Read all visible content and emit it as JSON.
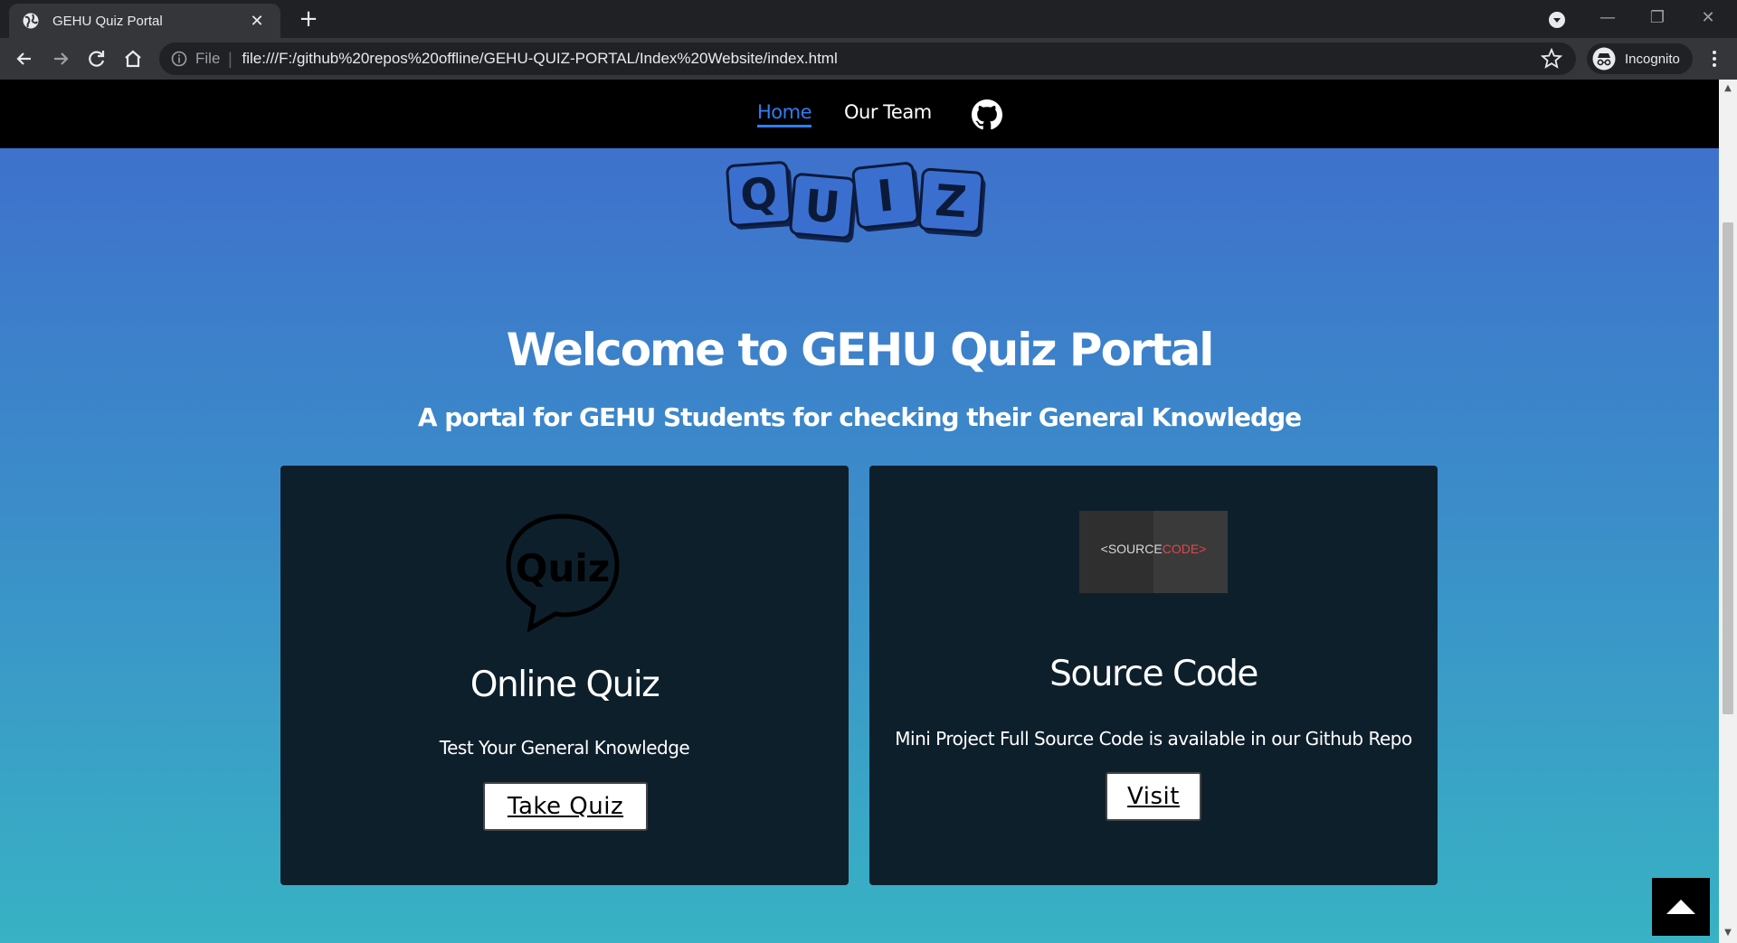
{
  "browser": {
    "tab_title": "GEHU Quiz Portal",
    "omnibox_scheme": "File",
    "url": "file:///F:/github%20repos%20offline/GEHU-QUIZ-PORTAL/Index%20Website/index.html",
    "profile_label": "Incognito"
  },
  "nav": {
    "home": "Home",
    "team": "Our Team",
    "github_icon": "github-icon"
  },
  "logo": {
    "letters": [
      "Q",
      "U",
      "I",
      "Z"
    ]
  },
  "hero": {
    "title": "Welcome to GEHU Quiz Portal",
    "subtitle": "A portal for GEHU Students for checking their General Knowledge"
  },
  "cards": {
    "quiz": {
      "image_text": "Quiz",
      "title": "Online Quiz",
      "text": "Test Your General Knowledge",
      "button": "Take Quiz"
    },
    "source": {
      "image_text_left": "<SOURCE",
      "image_text_right": "CODE>",
      "title": "Source Code",
      "text": "Mini Project Full Source Code is available in our Github Repo",
      "button": "Visit"
    }
  },
  "colors": {
    "accent": "#2f7df6",
    "card_bg": "#0e1f2c",
    "gradient_top": "#3f6ccd",
    "gradient_bottom": "#38b2c4"
  }
}
